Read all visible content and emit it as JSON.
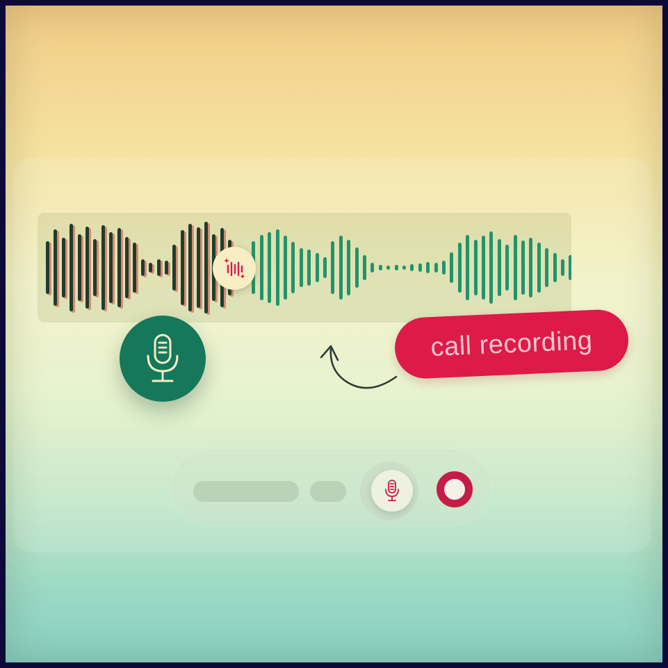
{
  "badge": {
    "label": "call recording"
  },
  "icons": {
    "playhead": "sparkle-waveform-icon",
    "primary_mic": "microphone-icon",
    "control_mic": "microphone-icon",
    "record": "record-icon",
    "arrow": "curved-arrow-icon"
  },
  "playback": {
    "progress": 0.39
  },
  "colors": {
    "accent_red": "#dd1a48",
    "record_red": "#c51c48",
    "mic_green": "#15785a",
    "wave_green": "#22936a",
    "wave_played": "#1f3d2e"
  },
  "waveform": {
    "levels": [
      0.55,
      0.8,
      0.62,
      0.92,
      0.7,
      0.85,
      0.6,
      0.88,
      0.74,
      0.82,
      0.64,
      0.52,
      0.18,
      0.1,
      0.18,
      0.14,
      0.48,
      0.78,
      0.92,
      0.84,
      0.96,
      0.7,
      0.82,
      0.58,
      0.42,
      0.3,
      0.55,
      0.68,
      0.74,
      0.8,
      0.66,
      0.54,
      0.4,
      0.38,
      0.3,
      0.22,
      0.55,
      0.66,
      0.58,
      0.42,
      0.26,
      0.1,
      0.06,
      0.05,
      0.06,
      0.05,
      0.07,
      0.08,
      0.12,
      0.1,
      0.14,
      0.32,
      0.52,
      0.68,
      0.58,
      0.66,
      0.76,
      0.6,
      0.48,
      0.68,
      0.56,
      0.62,
      0.52,
      0.4,
      0.3,
      0.18,
      0.26
    ]
  }
}
